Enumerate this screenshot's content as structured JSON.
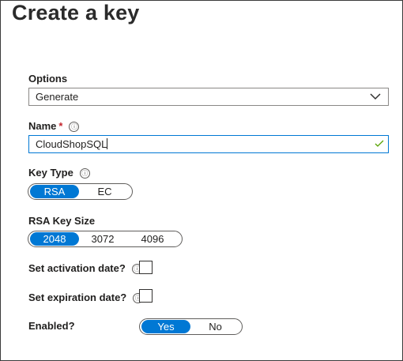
{
  "title": "Create a key",
  "options": {
    "label": "Options",
    "selected": "Generate",
    "chevron_icon": "chevron-down-icon"
  },
  "name": {
    "label": "Name",
    "required_mark": "*",
    "info_icon": "ⓘ",
    "value": "CloudShopSQL",
    "valid_icon": "checkmark-icon"
  },
  "key_type": {
    "label": "Key Type",
    "info_icon": "ⓘ",
    "options": [
      "RSA",
      "EC"
    ],
    "selected": "RSA"
  },
  "rsa_key_size": {
    "label": "RSA Key Size",
    "options": [
      "2048",
      "3072",
      "4096"
    ],
    "selected": "2048"
  },
  "activation": {
    "label": "Set activation date?",
    "info_icon": "ⓘ",
    "checked": false
  },
  "expiration": {
    "label": "Set expiration date?",
    "info_icon": "ⓘ",
    "checked": false
  },
  "enabled": {
    "label": "Enabled?",
    "options": [
      "Yes",
      "No"
    ],
    "selected": "Yes"
  },
  "colors": {
    "accent": "#0078d4",
    "required": "#c4262e",
    "valid": "#57a300"
  }
}
